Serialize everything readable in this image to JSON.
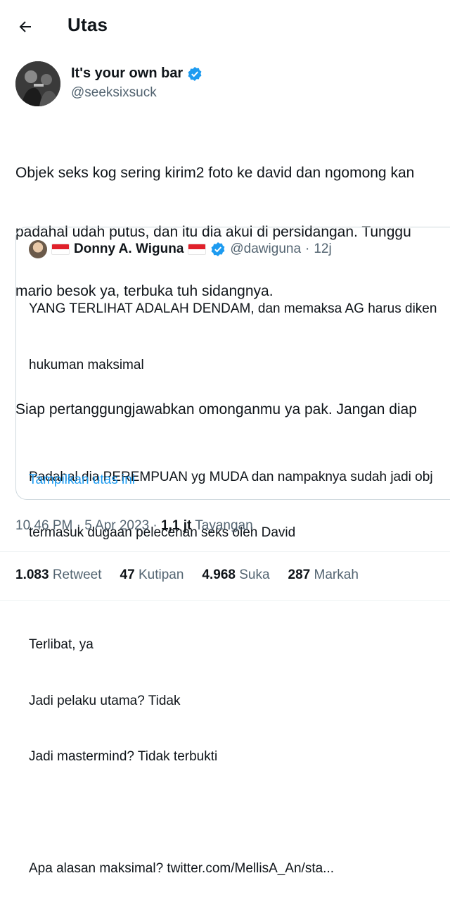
{
  "header": {
    "title": "Utas"
  },
  "author": {
    "name": "It's your own bar",
    "handle": "@seeksixsuck"
  },
  "tweet": {
    "lines": [
      "Objek seks kog sering kirim2 foto ke david dan ngomong kan",
      "padahal udah putus, dan itu dia akui di persidangan. Tunggu",
      "mario besok ya, terbuka tuh sidangnya.",
      "",
      "Siap pertanggungjawabkan omonganmu ya pak. Jangan diap"
    ]
  },
  "quote": {
    "name": "Donny A. Wiguna",
    "handle": "@dawiguna",
    "separator": "·",
    "time": "12j",
    "lines": [
      "YANG TERLIHAT ADALAH DENDAM, dan memaksa AG harus diken",
      "hukuman maksimal",
      "",
      "Padahal dia PEREMPUAN yg MUDA dan nampaknya sudah jadi obj",
      "termasuk dugaan pelecehan seks oleh David",
      "",
      "Terlibat, ya",
      "Jadi pelaku utama? Tidak",
      "Jadi mastermind? Tidak terbukti",
      "",
      "Apa alasan maksimal? twitter.com/MellisA_An/sta..."
    ],
    "show_thread": "Tampilkan utas ini"
  },
  "meta": {
    "time": "10.46 PM",
    "dot1": "·",
    "date": "5 Apr 2023",
    "dot2": "·",
    "views_count": "1,1 jt",
    "views_label": "Tayangan"
  },
  "stats": {
    "retweets": {
      "count": "1.083",
      "label": "Retweet"
    },
    "quotes": {
      "count": "47",
      "label": "Kutipan"
    },
    "likes": {
      "count": "4.968",
      "label": "Suka"
    },
    "bookmarks": {
      "count": "287",
      "label": "Markah"
    }
  },
  "colors": {
    "accent": "#1d9bf0",
    "muted": "#536471",
    "text": "#0f1419",
    "border": "#cfd9de"
  }
}
